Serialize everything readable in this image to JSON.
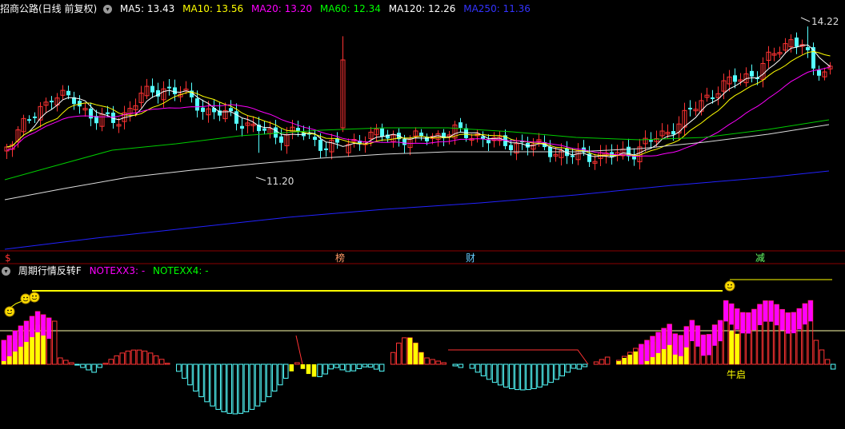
{
  "main_header": {
    "title": "招商公路(日线 前复权)",
    "ma": [
      {
        "label": "MA5: 13.43",
        "color": "#ffffff"
      },
      {
        "label": "MA10: 13.56",
        "color": "#ffff00"
      },
      {
        "label": "MA20: 13.20",
        "color": "#ff00ff"
      },
      {
        "label": "MA60: 12.34",
        "color": "#00ff00"
      },
      {
        "label": "MA120: 12.26",
        "color": "#ffffff"
      },
      {
        "label": "MA250: 11.36",
        "color": "#3333ff"
      }
    ]
  },
  "price_labels": {
    "high": "14.22",
    "low": "11.20"
  },
  "event_markers": [
    {
      "text": "$",
      "color": "#ff3333"
    },
    {
      "text": "榜",
      "color": "#ff9966"
    },
    {
      "text": "财",
      "color": "#66ccff"
    },
    {
      "text": "减",
      "color": "#66ff66"
    }
  ],
  "indicator_header": {
    "title": "周期行情反转F",
    "items": [
      {
        "label": "NOTEXX3: -",
        "color": "#ff00ff"
      },
      {
        "label": "NOTEXX4: -",
        "color": "#00ff00"
      }
    ]
  },
  "indicator_label": "牛启",
  "colors": {
    "up": "#ff3333",
    "down": "#54ffff",
    "ma5": "#ffffff",
    "ma10": "#ffff00",
    "ma20": "#ff00ff",
    "ma60": "#00cc00",
    "ma120": "#dddddd",
    "ma250": "#2222ff",
    "magenta_bar": "#ff00ff",
    "yellow_bar": "#ffff00",
    "cyan_bar": "#54ffff",
    "red_bar": "#ff3333"
  }
}
